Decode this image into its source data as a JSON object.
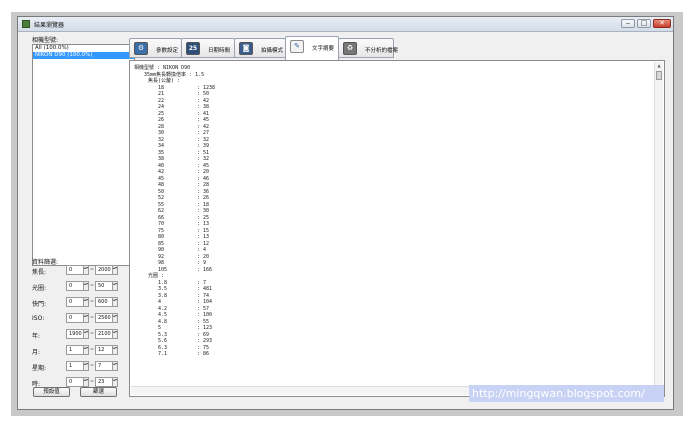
{
  "window": {
    "title": "結果瀏覽器"
  },
  "left_panel": {
    "camera_label": "相機型號:",
    "cameras": [
      "All (100.0%)",
      "NIKON D90 (100.0%)"
    ],
    "filter_title": "資料篩選:",
    "filters": [
      {
        "label": "焦長:",
        "from": "0",
        "to": "2000"
      },
      {
        "label": "光圈:",
        "from": "0",
        "to": "50"
      },
      {
        "label": "快門:",
        "from": "0",
        "to": "600"
      },
      {
        "label": "ISO:",
        "from": "0",
        "to": "2560"
      },
      {
        "label": "年:",
        "from": "1900",
        "to": "2100"
      },
      {
        "label": "月:",
        "from": "1",
        "to": "12"
      },
      {
        "label": "星期:",
        "from": "1",
        "to": "7"
      },
      {
        "label": "時:",
        "from": "0",
        "to": "23"
      }
    ],
    "default_button": "預設值",
    "filter_button": "篩選"
  },
  "tabs": [
    {
      "label": "參數設定",
      "icon": "settings-icon",
      "active": false
    },
    {
      "label": "日期時間",
      "icon": "calendar-icon",
      "calendar_day": "25",
      "active": false
    },
    {
      "label": "拍攝模式",
      "icon": "camera-mode-icon",
      "active": false
    },
    {
      "label": "文字摘要",
      "icon": "notepad-icon",
      "active": true
    },
    {
      "label": "不分析的檔案",
      "icon": "trash-icon",
      "active": false
    }
  ],
  "report": {
    "camera_line": "相機型號 : NIKON D90",
    "conversion_line": "35mm焦長轉換倍率 : 1.5",
    "focal_header": "焦長(公釐) :",
    "focal_lengths": [
      [
        "18",
        "1238"
      ],
      [
        "21",
        "50"
      ],
      [
        "22",
        "42"
      ],
      [
        "24",
        "38"
      ],
      [
        "25",
        "41"
      ],
      [
        "26",
        "45"
      ],
      [
        "28",
        "42"
      ],
      [
        "30",
        "27"
      ],
      [
        "32",
        "32"
      ],
      [
        "34",
        "39"
      ],
      [
        "35",
        "51"
      ],
      [
        "38",
        "32"
      ],
      [
        "40",
        "45"
      ],
      [
        "42",
        "20"
      ],
      [
        "45",
        "46"
      ],
      [
        "48",
        "28"
      ],
      [
        "50",
        "36"
      ],
      [
        "52",
        "26"
      ],
      [
        "55",
        "18"
      ],
      [
        "62",
        "30"
      ],
      [
        "66",
        "25"
      ],
      [
        "70",
        "13"
      ],
      [
        "75",
        "15"
      ],
      [
        "80",
        "13"
      ],
      [
        "85",
        "12"
      ],
      [
        "90",
        "4"
      ],
      [
        "92",
        "20"
      ],
      [
        "98",
        "9"
      ],
      [
        "105",
        "166"
      ]
    ],
    "aperture_header": "光圈 :",
    "apertures": [
      [
        "1.8",
        "7"
      ],
      [
        "3.5",
        "481"
      ],
      [
        "3.8",
        "74"
      ],
      [
        "4",
        "104"
      ],
      [
        "4.2",
        "57"
      ],
      [
        "4.5",
        "100"
      ],
      [
        "4.8",
        "55"
      ],
      [
        "5",
        "123"
      ],
      [
        "5.3",
        "69"
      ],
      [
        "5.6",
        "293"
      ],
      [
        "6.3",
        "75"
      ],
      [
        "7.1",
        "86"
      ]
    ]
  },
  "watermark": "http://mingqwan.blogspot.com/"
}
